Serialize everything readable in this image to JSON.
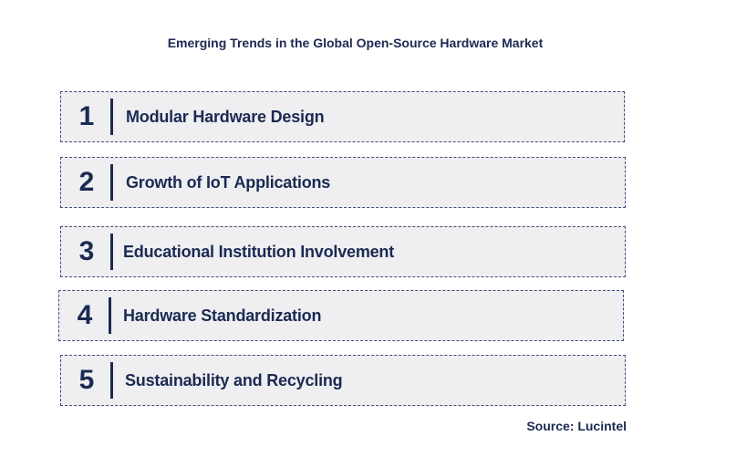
{
  "title": "Emerging Trends in the Global Open-Source Hardware Market",
  "trends": [
    {
      "number": "1",
      "label": "Modular Hardware Design"
    },
    {
      "number": "2",
      "label": "Growth of IoT Applications"
    },
    {
      "number": "3",
      "label": "Educational Institution Involvement"
    },
    {
      "number": "4",
      "label": "Hardware Standardization"
    },
    {
      "number": "5",
      "label": "Sustainability and Recycling"
    }
  ],
  "source": "Source: Lucintel",
  "colors": {
    "text": "#1b2a52",
    "box_fill": "#efeff1",
    "box_border": "#3d4f80"
  }
}
